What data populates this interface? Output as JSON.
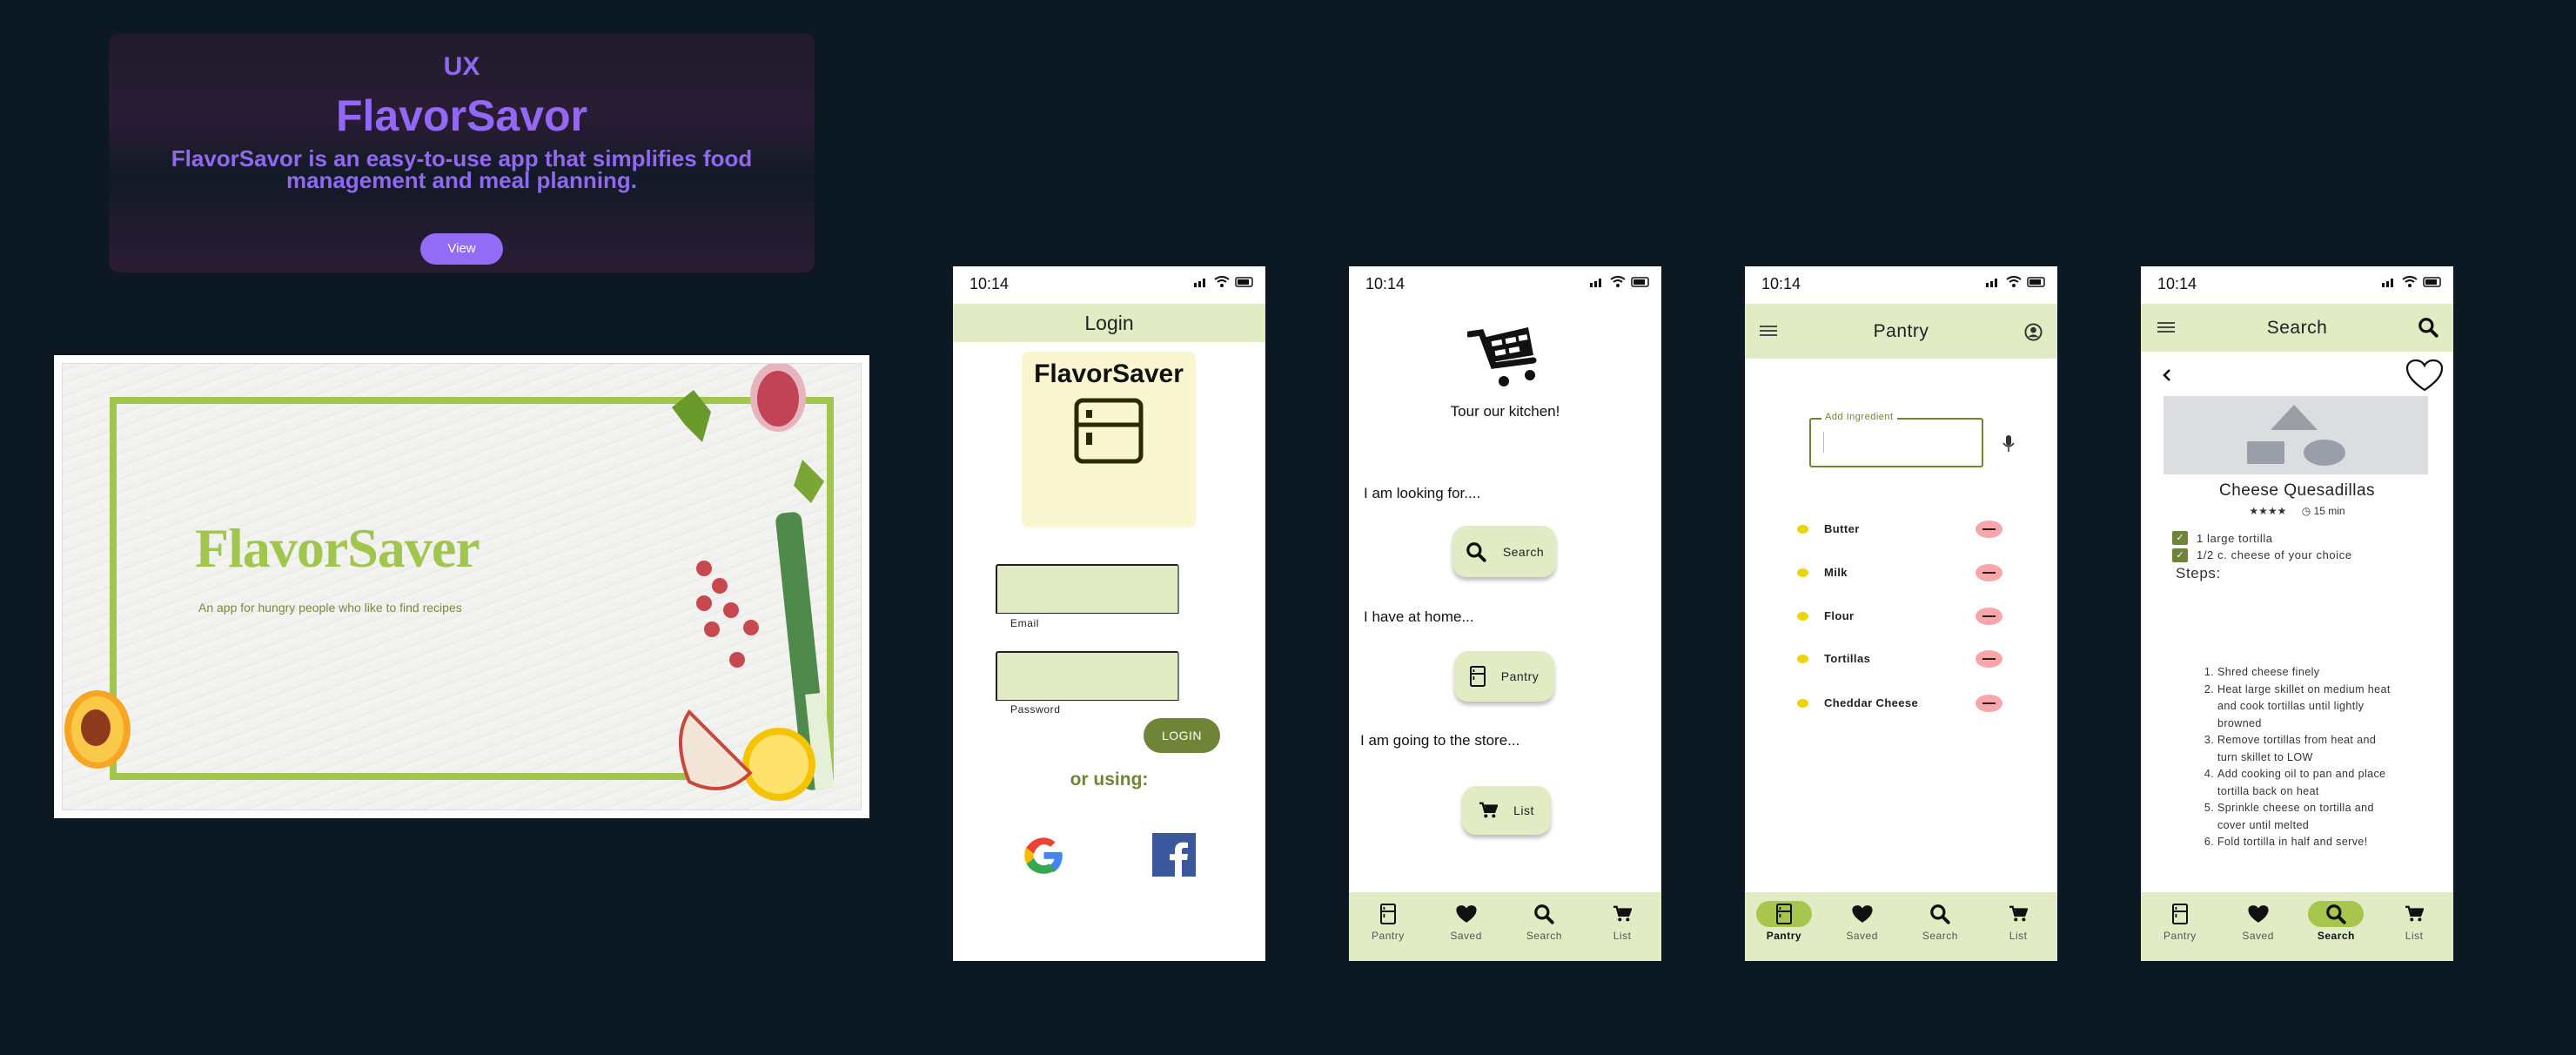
{
  "banner": {
    "category": "UX",
    "title": "FlavorSavor",
    "description": "FlavorSavor is an easy-to-use app that simplifies food management and meal planning.",
    "view_label": "View"
  },
  "poster": {
    "title": "FlavorSaver",
    "subtitle": "An app for hungry people who like to find recipes"
  },
  "status_time": "10:14",
  "login": {
    "header": "Login",
    "logo_text": "FlavorSaver",
    "email_label": "Email",
    "email_value": "",
    "password_label": "Password",
    "password_value": "",
    "login_button": "LOGIN",
    "alt_label": "or using:"
  },
  "home": {
    "tagline": "Tour our kitchen!",
    "prompts": [
      {
        "text": "I am looking for....",
        "button": "Search",
        "icon": "search-icon"
      },
      {
        "text": "I have at home...",
        "button": "Pantry",
        "icon": "fridge-icon"
      },
      {
        "text": "I am going to the store...",
        "button": "List",
        "icon": "cart-icon"
      }
    ]
  },
  "pantry": {
    "header": "Pantry",
    "add_label": "Add Ingredient",
    "add_value": "",
    "items": [
      "Butter",
      "Milk",
      "Flour",
      "Tortillas",
      "Cheddar Cheese"
    ]
  },
  "search": {
    "header": "Search",
    "recipe_title": "Cheese Quesadillas",
    "rating_stars": "★★★★",
    "rating": 4,
    "time": "15 min",
    "ingredients": [
      {
        "text": "1 large tortilla",
        "checked": true
      },
      {
        "text": "1/2 c. cheese of your choice",
        "checked": true
      }
    ],
    "steps_label": "Steps:",
    "steps": [
      "Shred cheese finely",
      "Heat large skillet on medium heat and cook tortillas until lightly browned",
      "Remove tortillas from heat and turn skillet to LOW",
      "Add cooking oil to pan and place tortilla back on heat",
      "Sprinkle cheese on tortilla and cover until melted",
      "Fold tortilla in half and serve!"
    ]
  },
  "nav_items": [
    {
      "label": "Pantry",
      "icon": "fridge-icon"
    },
    {
      "label": "Saved",
      "icon": "heart-icon"
    },
    {
      "label": "Search",
      "icon": "search-icon"
    },
    {
      "label": "List",
      "icon": "cart-icon"
    }
  ],
  "nav_active": {
    "home": -1,
    "pantry": 0,
    "search": 2
  },
  "colors": {
    "background": "#0c1922",
    "accent_purple": "#926cf7",
    "app_green_light": "#e1ebc4",
    "app_green_dark": "#6e8436",
    "nav_active": "#a8c64e",
    "logo_box": "#faf6cf",
    "remove_pink": "#f8a6a9",
    "bullet_yellow": "#ecd400",
    "poster_green": "#a0c64d"
  }
}
